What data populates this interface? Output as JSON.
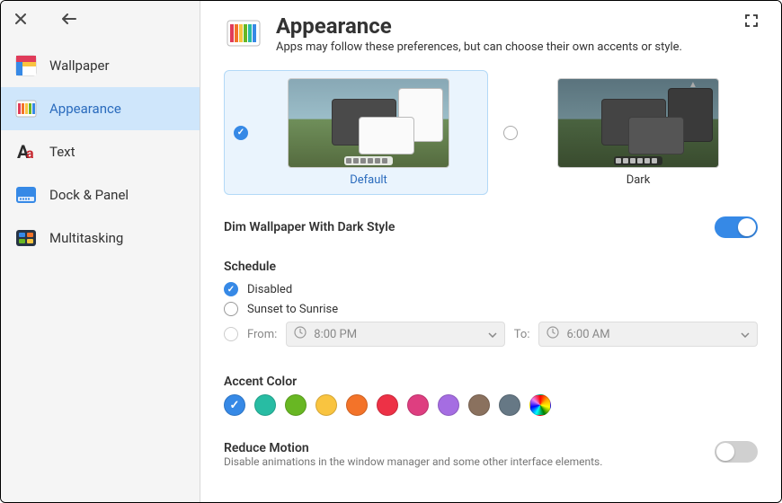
{
  "sidebar": {
    "items": [
      {
        "label": "Wallpaper"
      },
      {
        "label": "Appearance"
      },
      {
        "label": "Text"
      },
      {
        "label": "Dock & Panel"
      },
      {
        "label": "Multitasking"
      }
    ],
    "selected_index": 1
  },
  "header": {
    "title": "Appearance",
    "subtitle": "Apps may follow these preferences, but can choose their own accents or style."
  },
  "themes": {
    "options": [
      {
        "label": "Default",
        "selected": true
      },
      {
        "label": "Dark",
        "selected": false
      }
    ]
  },
  "dim_wallpaper": {
    "label": "Dim Wallpaper With Dark Style",
    "enabled": true
  },
  "schedule": {
    "title": "Schedule",
    "options": [
      {
        "label": "Disabled",
        "checked": true
      },
      {
        "label": "Sunset to Sunrise",
        "checked": false
      }
    ],
    "from_label": "From:",
    "to_label": "To:",
    "from_value": "8:00 PM",
    "to_value": "6:00 AM"
  },
  "accent": {
    "title": "Accent Color",
    "colors": [
      {
        "name": "blue",
        "hex": "#3689e6",
        "selected": true
      },
      {
        "name": "teal",
        "hex": "#28bca3",
        "selected": false
      },
      {
        "name": "green",
        "hex": "#68b723",
        "selected": false
      },
      {
        "name": "yellow",
        "hex": "#f9c440",
        "selected": false
      },
      {
        "name": "orange",
        "hex": "#f37329",
        "selected": false
      },
      {
        "name": "red",
        "hex": "#ed3146",
        "selected": false
      },
      {
        "name": "pink",
        "hex": "#de3e80",
        "selected": false
      },
      {
        "name": "purple",
        "hex": "#a56de2",
        "selected": false
      },
      {
        "name": "brown",
        "hex": "#8a715e",
        "selected": false
      },
      {
        "name": "slate",
        "hex": "#667885",
        "selected": false
      },
      {
        "name": "auto",
        "hex": "rainbow",
        "selected": false
      }
    ]
  },
  "reduce_motion": {
    "label": "Reduce Motion",
    "description": "Disable animations in the window manager and some other interface elements.",
    "enabled": false
  }
}
